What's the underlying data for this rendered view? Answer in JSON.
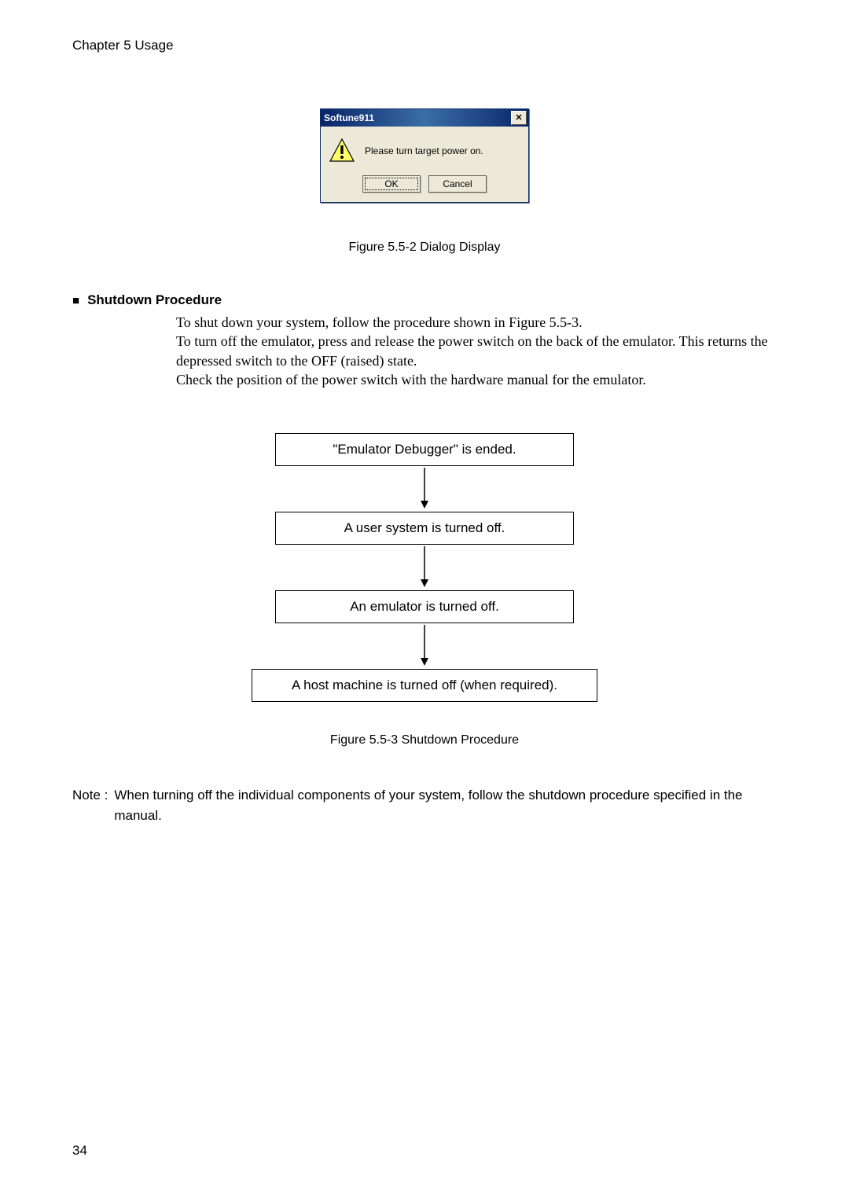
{
  "header": "Chapter 5 Usage",
  "dialog": {
    "title": "Softune911",
    "close_glyph": "✕",
    "message": "Please turn target power on.",
    "ok_label": "OK",
    "cancel_label": "Cancel"
  },
  "figure1_caption": "Figure 5.5-2 Dialog Display",
  "section": {
    "bullet": "■",
    "title": "Shutdown Procedure"
  },
  "body": {
    "p1": "To shut down your system, follow the procedure shown in Figure 5.5-3.",
    "p2": "To turn off the emulator, press and release the power switch on the back of the emulator. This returns the depressed switch to the OFF (raised) state.",
    "p3": "Check the position of the power switch with the hardware manual for the emulator."
  },
  "flow": {
    "step1": "\"Emulator Debugger\" is ended.",
    "step2": "A user system is turned off.",
    "step3": "An emulator is turned off.",
    "step4": "A host machine is turned off (when required)."
  },
  "figure2_caption": "Figure 5.5-3 Shutdown Procedure",
  "note": {
    "label": "Note :",
    "text": "When turning off the individual components of your system, follow the shutdown procedure specified in the manual."
  },
  "page_number": "34"
}
